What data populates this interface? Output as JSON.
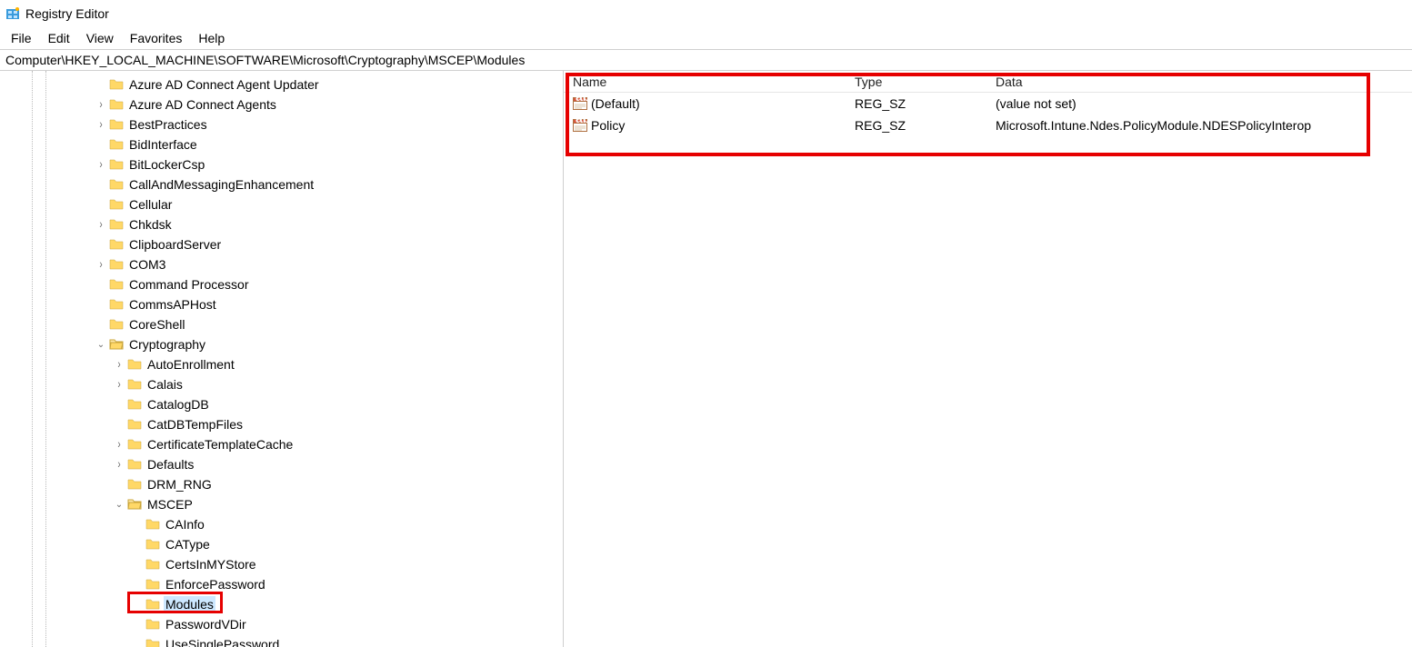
{
  "title": "Registry Editor",
  "menu": {
    "file": "File",
    "edit": "Edit",
    "view": "View",
    "favorites": "Favorites",
    "help": "Help"
  },
  "address": "Computer\\HKEY_LOCAL_MACHINE\\SOFTWARE\\Microsoft\\Cryptography\\MSCEP\\Modules",
  "tree": [
    {
      "label": "Azure AD Connect Agent Updater",
      "depth": 0,
      "exp": ""
    },
    {
      "label": "Azure AD Connect Agents",
      "depth": 0,
      "exp": ">"
    },
    {
      "label": "BestPractices",
      "depth": 0,
      "exp": ">"
    },
    {
      "label": "BidInterface",
      "depth": 0,
      "exp": ""
    },
    {
      "label": "BitLockerCsp",
      "depth": 0,
      "exp": ">"
    },
    {
      "label": "CallAndMessagingEnhancement",
      "depth": 0,
      "exp": ""
    },
    {
      "label": "Cellular",
      "depth": 0,
      "exp": ""
    },
    {
      "label": "Chkdsk",
      "depth": 0,
      "exp": ">"
    },
    {
      "label": "ClipboardServer",
      "depth": 0,
      "exp": ""
    },
    {
      "label": "COM3",
      "depth": 0,
      "exp": ">"
    },
    {
      "label": "Command Processor",
      "depth": 0,
      "exp": ""
    },
    {
      "label": "CommsAPHost",
      "depth": 0,
      "exp": ""
    },
    {
      "label": "CoreShell",
      "depth": 0,
      "exp": ""
    },
    {
      "label": "Cryptography",
      "depth": 0,
      "exp": "v",
      "open": true
    },
    {
      "label": "AutoEnrollment",
      "depth": 1,
      "exp": ">"
    },
    {
      "label": "Calais",
      "depth": 1,
      "exp": ">"
    },
    {
      "label": "CatalogDB",
      "depth": 1,
      "exp": ""
    },
    {
      "label": "CatDBTempFiles",
      "depth": 1,
      "exp": ""
    },
    {
      "label": "CertificateTemplateCache",
      "depth": 1,
      "exp": ">"
    },
    {
      "label": "Defaults",
      "depth": 1,
      "exp": ">"
    },
    {
      "label": "DRM_RNG",
      "depth": 1,
      "exp": ""
    },
    {
      "label": "MSCEP",
      "depth": 1,
      "exp": "v",
      "open": true
    },
    {
      "label": "CAInfo",
      "depth": 2,
      "exp": ""
    },
    {
      "label": "CAType",
      "depth": 2,
      "exp": ""
    },
    {
      "label": "CertsInMYStore",
      "depth": 2,
      "exp": ""
    },
    {
      "label": "EnforcePassword",
      "depth": 2,
      "exp": ""
    },
    {
      "label": "Modules",
      "depth": 2,
      "exp": "",
      "selected": true,
      "hl": true
    },
    {
      "label": "PasswordVDir",
      "depth": 2,
      "exp": ""
    },
    {
      "label": "UseSinglePassword",
      "depth": 2,
      "exp": ""
    }
  ],
  "columns": {
    "name": "Name",
    "type": "Type",
    "data": "Data"
  },
  "values": [
    {
      "name": "(Default)",
      "type": "REG_SZ",
      "data": "(value not set)"
    },
    {
      "name": "Policy",
      "type": "REG_SZ",
      "data": "Microsoft.Intune.Ndes.PolicyModule.NDESPolicyInterop"
    }
  ]
}
